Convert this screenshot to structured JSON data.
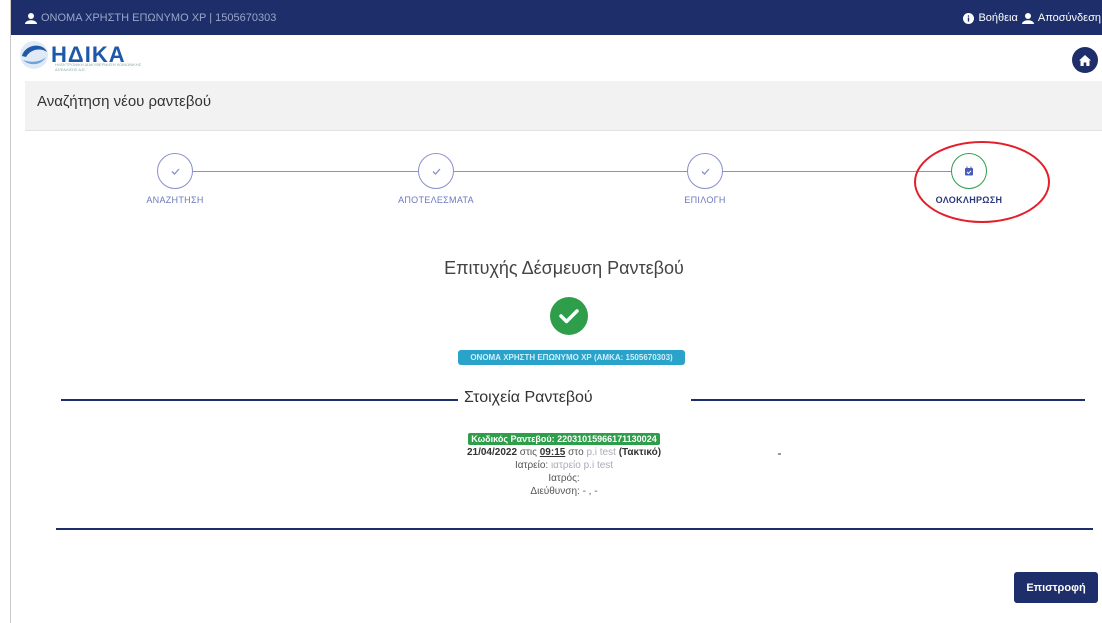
{
  "topbar": {
    "user_text": "ΟΝΟΜΑ ΧΡΗΣΤΗ ΕΠΩΝΥΜΟ ΧΡ | 1505670303",
    "help_label": "Βοήθεια",
    "logout_label": "Αποσύνδεση"
  },
  "logo": {
    "name": "ΗΔΙΚΑ",
    "subtitle": "ΗΛΕΚΤΡΟΝΙΚΗ ΔΙΑΚΥΒΕΡΝΗΣΗ ΚΟΙΝΩΝΙΚΗΣ ΑΣΦΑΛΙΣΗΣ Α.Ε."
  },
  "page": {
    "title": "Αναζήτηση νέου ραντεβού"
  },
  "stepper": {
    "steps": [
      {
        "label": "ΑΝΑΖΗΤΗΣΗ",
        "state": "done"
      },
      {
        "label": "ΑΠΟΤΕΛΕΣΜΑΤΑ",
        "state": "done"
      },
      {
        "label": "ΕΠΙΛΟΓΗ",
        "state": "done"
      },
      {
        "label": "ΟΛΟΚΛΗΡΩΣΗ",
        "state": "active"
      }
    ]
  },
  "result": {
    "title": "Επιτυχής Δέσμευση Ραντεβού",
    "patient_badge": "ΟΝΟΜΑ ΧΡΗΣΤΗ ΕΠΩΝΥΜΟ ΧΡ (ΑΜΚΑ: 1505670303)"
  },
  "details": {
    "section_title": "Στοιχεία Ραντεβού",
    "code_label": "Κωδικός Ραντεβού: 220310159661711300​24",
    "date": "21/04/2022",
    "at_word": "στις",
    "time": "09:15",
    "place_word": "στο",
    "place_value": "p.i test",
    "type": "(Τακτικό)",
    "clinic_label": "Ιατρείο:",
    "clinic_value": "ιατρείο p.i test",
    "doctor_label": "Ιατρός:",
    "address_label": "Διεύθυνση:",
    "address_value": "- , -"
  },
  "actions": {
    "back_label": "Επιστροφή"
  },
  "colors": {
    "navy": "#1d2e6a",
    "success": "#2e9e4b",
    "stepper_line": "#8a8fd0",
    "annotation_red": "#e21f2a",
    "badge_blue": "#29a3c9"
  }
}
